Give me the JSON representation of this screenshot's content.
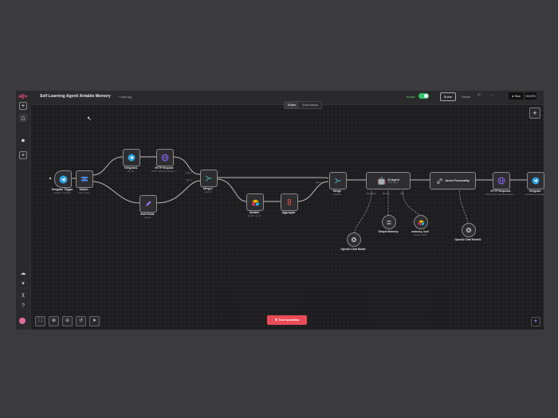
{
  "header": {
    "title": "Self Learning Agent/ Airtable Memory",
    "add_tag": "+ Add tag",
    "inactive_label": "Active",
    "share_label": "Share",
    "saved_label": "Saved",
    "star_label": "Star",
    "stars_count": "93,978"
  },
  "tabs": {
    "editor": "Editor",
    "executions": "Executions"
  },
  "nodes": {
    "telegram_trigger": {
      "label": "Telegram Trigger",
      "sub": "Updates: message"
    },
    "switch": {
      "label": "Switch",
      "sub": "mode: Rules"
    },
    "telegram1": {
      "label": "Telegram1",
      "sub": "get: file"
    },
    "http_request": {
      "label": "HTTP Request",
      "sub": "POST: https://api.openai.c..."
    },
    "edit_fields": {
      "label": "Edit Fields",
      "sub": "manual"
    },
    "merge1": {
      "label": "Merge1",
      "sub": "append"
    },
    "airtable": {
      "label": "Airtable",
      "sub": "search: record"
    },
    "aggregate": {
      "label": "Aggregate",
      "sub": ""
    },
    "merge": {
      "label": "Merge",
      "sub": "combine"
    },
    "ai_agent": {
      "label": "AI Agent",
      "sub": "Tools Agent"
    },
    "jarvis": {
      "label": "Jarvis Personality",
      "sub": ""
    },
    "http_request1": {
      "label": "HTTP Request1",
      "sub": "POST: https://api.elevenlabs.io..."
    },
    "telegram": {
      "label": "Telegram",
      "sub": "sendAudio: message"
    },
    "openai_chat_model": {
      "label": "OpenAI Chat Model",
      "sub": ""
    },
    "simple_memory": {
      "label": "Simple Memory",
      "sub": ""
    },
    "memory_tool": {
      "label": "memory_tool",
      "sub": "create: record"
    },
    "openai_chat_model1": {
      "label": "OpenAI Chat Model1",
      "sub": ""
    }
  },
  "pins": {
    "chat_model": "Chat Model",
    "memory": "Memory",
    "tool": "Tool",
    "input": "Input 1",
    "input2": "Input 2"
  },
  "test_button": "Test workflow",
  "icons": {
    "logo": "n8n-logo-icon",
    "home": "home-icon",
    "user": "user-icon",
    "add": "plus-icon",
    "zoom_fit": "fit-view-icon",
    "zoom_in": "zoom-in-icon",
    "zoom_out": "zoom-out-icon",
    "reset": "reset-icon",
    "pointer": "pointer-icon"
  },
  "colors": {
    "accent": "#ea4b71",
    "active": "#36c26a",
    "telegram": "#2aa3e0",
    "http": "#8a6cff",
    "airtable": "#fcb400"
  }
}
